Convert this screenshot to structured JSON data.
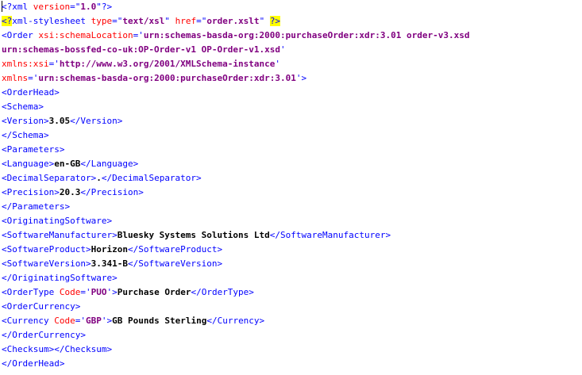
{
  "colors": {
    "tag": "#0000ff",
    "attr": "#ff0000",
    "value": "#800080",
    "text": "#000000",
    "pi_highlight": "#ffff00"
  },
  "lines": {
    "l01": {
      "a": "<?",
      "b": "xml",
      "c": " version",
      "d": "=\"",
      "e": "1.0",
      "f": "\"",
      "g": "?>"
    },
    "l02": {
      "a": "<?",
      "b": "xml-stylesheet",
      "c": " type",
      "d": "=\"",
      "e": "text/xsl",
      "f": "\"",
      "g": " href",
      "h": "=\"",
      "i": "order.xslt",
      "j": "\"",
      "k": " ",
      "l": "?>"
    },
    "l03": {
      "a": "<Order",
      "b": " xsi:schemaLocation",
      "c": "='",
      "d": "urn:schemas-basda-org:2000:purchaseOrder:xdr:3.01 order-v3.xsd"
    },
    "l04": {
      "a": "urn:schemas-bossfed-co-uk:OP-Order-v1 OP-Order-v1.xsd",
      "b": "'"
    },
    "l05": {
      "a": "xmlns:xsi",
      "b": "='",
      "c": "http://www.w3.org/2001/XMLSchema-instance",
      "d": "'"
    },
    "l06": {
      "a": "xmlns",
      "b": "='",
      "c": "urn:schemas-basda-org:2000:purchaseOrder:xdr:3.01",
      "d": "'",
      "e": ">"
    },
    "l07": "<OrderHead>",
    "l08": "<Schema>",
    "l09": {
      "a": "<Version>",
      "b": "3.05",
      "c": "</Version>"
    },
    "l10": "</Schema>",
    "l11": "<Parameters>",
    "l12": {
      "a": "<Language>",
      "b": "en-GB",
      "c": "</Language>"
    },
    "l13": {
      "a": "<DecimalSeparator>",
      "b": ".",
      "c": "</DecimalSeparator>"
    },
    "l14": {
      "a": "<Precision>",
      "b": "20.3",
      "c": "</Precision>"
    },
    "l15": "</Parameters>",
    "l16": "<OriginatingSoftware>",
    "l17": {
      "a": "<SoftwareManufacturer>",
      "b": "Bluesky Systems Solutions Ltd",
      "c": "</SoftwareManufacturer>"
    },
    "l18": {
      "a": "<SoftwareProduct>",
      "b": "Horizon",
      "c": "</SoftwareProduct>"
    },
    "l19": {
      "a": "<SoftwareVersion>",
      "b": "3.341-B",
      "c": "</SoftwareVersion>"
    },
    "l20": "</OriginatingSoftware>",
    "l21": {
      "a": "<OrderType",
      "b": " Code",
      "c": "='",
      "d": "PUO",
      "e": "'",
      "f": ">",
      "g": "Purchase Order",
      "h": "</OrderType>"
    },
    "l22": "<OrderCurrency>",
    "l23": {
      "a": "<Currency",
      "b": " Code",
      "c": "='",
      "d": "GBP",
      "e": "'",
      "f": ">",
      "g": "GB Pounds Sterling",
      "h": "</Currency>"
    },
    "l24": "</OrderCurrency>",
    "l25": {
      "a": "<Checksum>",
      "b": "</Checksum>"
    },
    "l26": "</OrderHead>"
  }
}
